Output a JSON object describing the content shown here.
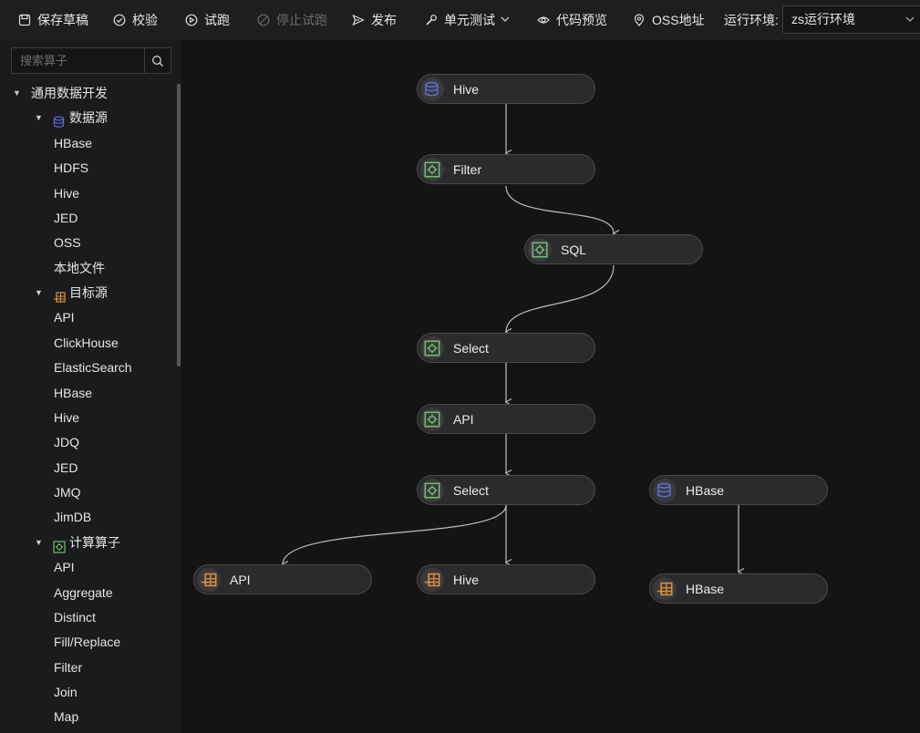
{
  "toolbar": {
    "save_draft": "保存草稿",
    "validate": "校验",
    "trial_run": "试跑",
    "stop_trial": "停止试跑",
    "publish": "发布",
    "unit_test": "单元测试",
    "code_preview": "代码预览",
    "oss_address": "OSS地址",
    "env_label": "运行环境:",
    "env_value": "zs运行环境"
  },
  "sidebar": {
    "search_placeholder": "搜索算子",
    "root": "通用数据开发",
    "groups": [
      {
        "label": "数据源",
        "items": [
          "HBase",
          "HDFS",
          "Hive",
          "JED",
          "OSS",
          "本地文件"
        ]
      },
      {
        "label": "目标源",
        "items": [
          "API",
          "ClickHouse",
          "ElasticSearch",
          "HBase",
          "Hive",
          "JDQ",
          "JED",
          "JMQ",
          "JimDB"
        ]
      },
      {
        "label": "计算算子",
        "items": [
          "API",
          "Aggregate",
          "Distinct",
          "Fill/Replace",
          "Filter",
          "Join",
          "Map"
        ]
      }
    ]
  },
  "canvas": {
    "nodes": [
      {
        "label": "Hive",
        "kind": "source"
      },
      {
        "label": "Filter",
        "kind": "compute"
      },
      {
        "label": "SQL",
        "kind": "compute"
      },
      {
        "label": "Select",
        "kind": "compute"
      },
      {
        "label": "API",
        "kind": "compute"
      },
      {
        "label": "Select",
        "kind": "compute"
      },
      {
        "label": "HBase",
        "kind": "source"
      },
      {
        "label": "API",
        "kind": "target"
      },
      {
        "label": "Hive",
        "kind": "target"
      },
      {
        "label": "HBase",
        "kind": "target"
      }
    ]
  },
  "colors": {
    "source_icon": "#5b6fd6",
    "target_icon": "#e0913a",
    "compute_icon": "#6fbf73"
  }
}
